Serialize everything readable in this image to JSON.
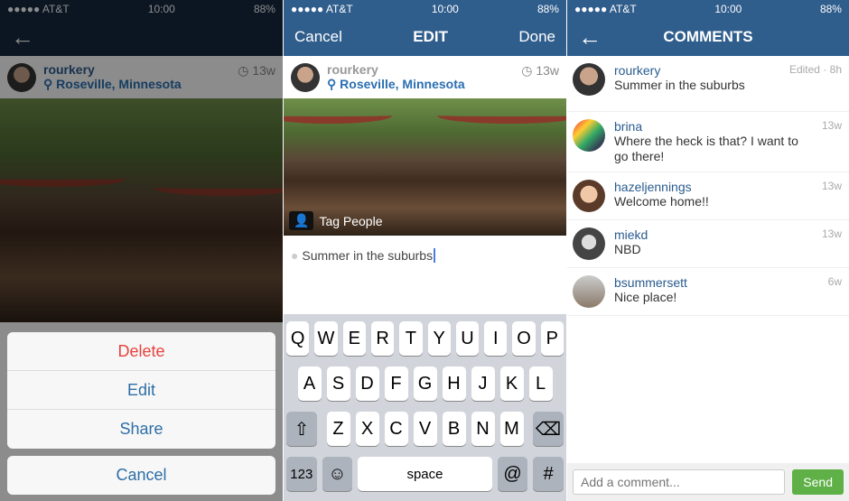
{
  "status": {
    "carrier": "●●●●● AT&T",
    "time": "10:00",
    "battery": "88%"
  },
  "post": {
    "username": "rourkery",
    "location": "Roseville, Minnesota",
    "age": "13w"
  },
  "action_sheet": {
    "delete": "Delete",
    "edit": "Edit",
    "share": "Share",
    "cancel": "Cancel"
  },
  "edit": {
    "cancel": "Cancel",
    "title": "EDIT",
    "done": "Done",
    "tag_people": "Tag People",
    "caption": "Summer in the suburbs"
  },
  "keyboard": {
    "rows": [
      [
        "Q",
        "W",
        "E",
        "R",
        "T",
        "Y",
        "U",
        "I",
        "O",
        "P"
      ],
      [
        "A",
        "S",
        "D",
        "F",
        "G",
        "H",
        "J",
        "K",
        "L"
      ],
      [
        "Z",
        "X",
        "C",
        "V",
        "B",
        "N",
        "M"
      ]
    ],
    "numbers": "123",
    "space": "space",
    "at": "@",
    "hash": "#"
  },
  "comments_screen": {
    "title": "COMMENTS",
    "placeholder": "Add a comment...",
    "send": "Send",
    "items": [
      {
        "user": "rourkery",
        "text": "Summer in the suburbs",
        "time": "Edited · 8h"
      },
      {
        "user": "brina",
        "text": "Where the heck is that? I want to go there!",
        "time": "13w"
      },
      {
        "user": "hazeljennings",
        "text": "Welcome home!!",
        "time": "13w"
      },
      {
        "user": "miekd",
        "text": "NBD",
        "time": "13w"
      },
      {
        "user": "bsummersett",
        "text": "Nice place!",
        "time": "6w"
      }
    ]
  }
}
